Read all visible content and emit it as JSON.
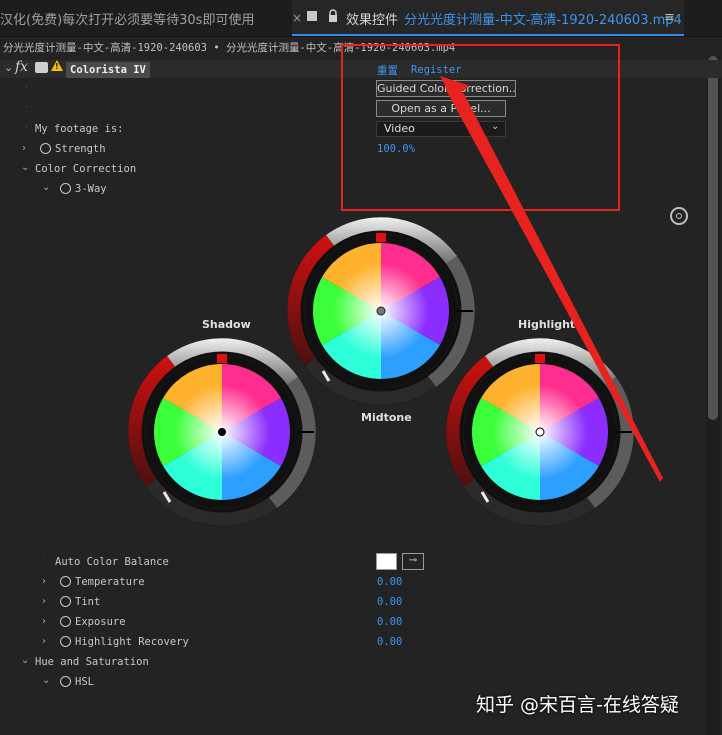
{
  "tabs": {
    "tab1_label": "汉化(免费)每次打开必须要等待30s即可使用",
    "tab1_close": "×",
    "tab2_label": "效果控件",
    "tab2_file": "分光光度计测量-中文-高清-1920-240603.mp4",
    "menu_icon": "menu-icon"
  },
  "sequence_line": "分光光度计测量-中文-高清-1920-240603 • 分光光度计测量-中文-高清-1920-240603.mp4",
  "effect": {
    "name": "Colorista IV",
    "fx": "fx",
    "reset_link": "重置",
    "register_link": "Register",
    "guided_button": "Guided Color Correction...",
    "panel_button": "Open as a Panel..."
  },
  "params": {
    "footage_label": "My footage is:",
    "footage_value": "Video",
    "strength_label": "Strength",
    "strength_value": "100.0%",
    "color_correction": "Color Correction",
    "three_way": "3-Way"
  },
  "wheels": {
    "shadow": "Shadow",
    "midtone": "Midtone",
    "highlight": "Highlight"
  },
  "balance": {
    "auto_label": "Auto Color Balance",
    "temperature_label": "Temperature",
    "temperature_value": "0.00",
    "tint_label": "Tint",
    "tint_value": "0.00",
    "exposure_label": "Exposure",
    "exposure_value": "0.00",
    "highlight_recovery_label": "Highlight Recovery",
    "highlight_recovery_value": "0.00",
    "hue_sat_label": "Hue and Saturation",
    "hsl_label": "HSL"
  },
  "watermark": "知乎 @宋百言-在线答疑",
  "colors": {
    "accent_blue": "#3c96f0",
    "annotation_red": "#e8231f",
    "panel_bg": "#232323"
  }
}
